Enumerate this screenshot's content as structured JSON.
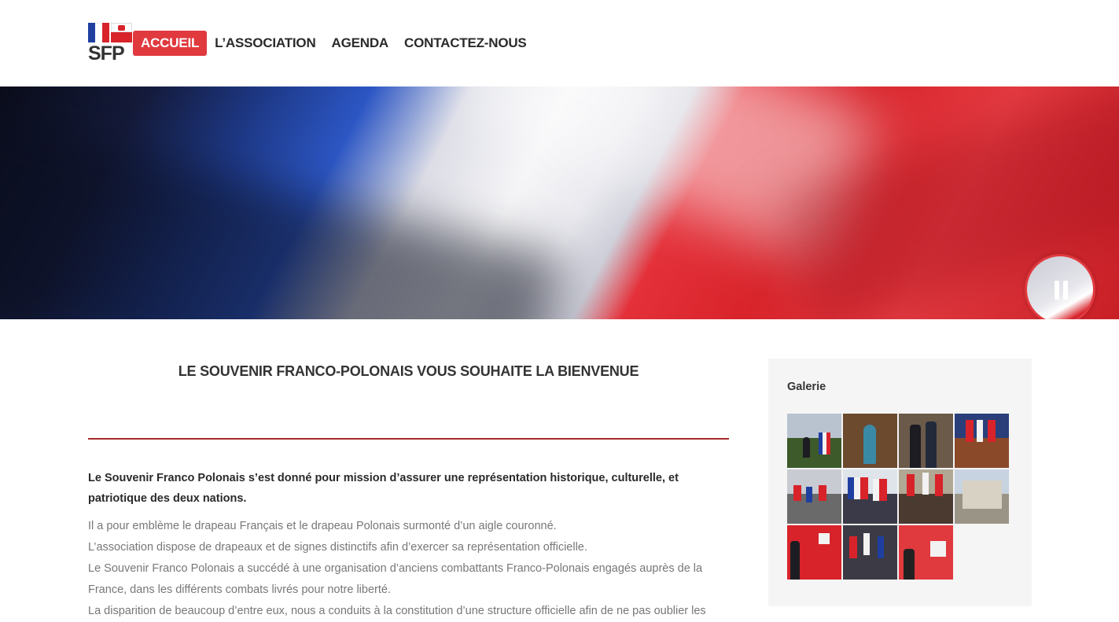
{
  "header": {
    "logo_text": "SFP",
    "nav": [
      {
        "label": "ACCUEIL",
        "active": true
      },
      {
        "label": "L’ASSOCIATION",
        "active": false
      },
      {
        "label": "AGENDA",
        "active": false
      },
      {
        "label": "CONTACTEZ-NOUS",
        "active": false
      }
    ]
  },
  "hero": {
    "player_icon": "pause-icon"
  },
  "main": {
    "title": "LE SOUVENIR FRANCO-POLONAIS VOUS SOUHAITE LA BIENVENUE",
    "mission": "Le Souvenir Franco Polonais s’est donné pour mission d’assurer une représentation historique, culturelle, et patriotique des deux nations.",
    "paragraphs": [
      "Il a pour emblème le drapeau Français et le drapeau Polonais surmonté d’un aigle couronné.",
      "L’association dispose de drapeaux et de signes distinctifs afin d’exercer sa représentation officielle.",
      "Le Souvenir Franco Polonais a succédé à une organisation d’anciens combattants Franco-Polonais engagés auprès de la France, dans les différents combats livrés pour notre liberté.",
      "La disparition de beaucoup d’entre eux, nous a conduits à la constitution d’une structure officielle afin de ne pas oublier les"
    ]
  },
  "sidebar": {
    "gallery_title": "Galerie",
    "thumbnail_count": 11
  },
  "colors": {
    "accent": "#e0393e",
    "divider": "#a52a2a",
    "sidebar_bg": "#f5f5f5"
  }
}
